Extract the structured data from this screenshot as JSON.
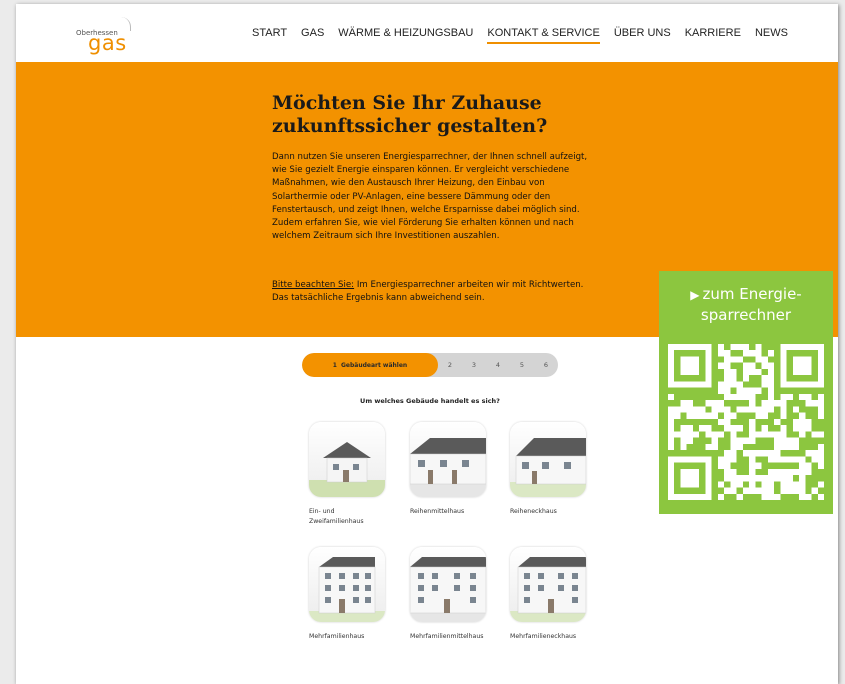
{
  "logo": {
    "small": "Oberhessen",
    "main": "gas"
  },
  "nav": {
    "items": [
      {
        "label": "START"
      },
      {
        "label": "GAS"
      },
      {
        "label": "WÄRME & HEIZUNGSBAU"
      },
      {
        "label": "KONTAKT & SERVICE",
        "active": true
      },
      {
        "label": "ÜBER UNS"
      },
      {
        "label": "KARRIERE"
      },
      {
        "label": "NEWS"
      }
    ]
  },
  "hero": {
    "title": "Möchten Sie Ihr Zuhause zukunftssicher gestalten?",
    "text": "Dann nutzen Sie unseren Energiesparrechner, der Ihnen schnell aufzeigt, wie Sie gezielt Energie einsparen können. Er vergleicht verschiedene Maßnahmen, wie den Austausch Ihrer Heizung, den Einbau von Solarthermie oder PV-Anlagen, eine bessere Dämmung oder den Fenstertausch, und zeigt Ihnen, welche Ersparnisse dabei möglich sind. Zudem erfahren Sie, wie viel Förderung Sie erhalten können und nach welchem Zeitraum sich Ihre Investitionen auszahlen.",
    "note_label": "Bitte beachten Sie:",
    "note_text": " Im Energiesparrechner arbeiten wir mit Richtwerten. Das tatsächliche Ergebnis kann abweichend sein."
  },
  "stepper": {
    "active_number": "1",
    "active_label": "Gebäudeart wählen",
    "steps": [
      "2",
      "3",
      "4",
      "5",
      "6"
    ]
  },
  "question": "Um welches Gebäude handelt es sich?",
  "buildings": [
    {
      "label": "Ein- und Zweifamilienhaus"
    },
    {
      "label": "Reihenmittelhaus"
    },
    {
      "label": "Reiheneckhaus"
    },
    {
      "label": "Mehrfamilienhaus"
    },
    {
      "label": "Mehrfamilienmittelhaus"
    },
    {
      "label": "Mehrfamilieneckhaus"
    }
  ],
  "qr": {
    "line1": "zum Energie-",
    "line2": "sparrechner",
    "icon": "play-triangle-icon"
  },
  "colors": {
    "brand_orange": "#f39200",
    "qr_green": "#8cc63f"
  }
}
